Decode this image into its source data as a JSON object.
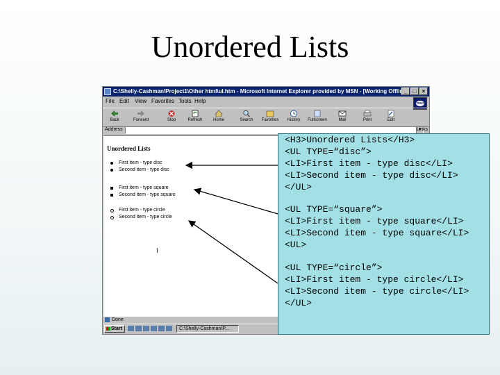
{
  "slide": {
    "title": "Unordered Lists"
  },
  "browser": {
    "title_bar": "C:\\Shelly-Cashman\\Project1\\Other html\\ul.htm - Microsoft Internet Explorer provided by MSN - [Working Offline",
    "menu": [
      "File",
      "Edit",
      "View",
      "Favorites",
      "Tools",
      "Help"
    ],
    "toolbar": [
      "Back",
      "Forward",
      "Stop",
      "Refresh",
      "Home",
      "Search",
      "Favorites",
      "History",
      "Fullscreen",
      "Mail",
      "Print",
      "Edit"
    ],
    "address_label": "Address",
    "address_value": "",
    "links_label": "Links",
    "status_text": "Done",
    "start_label": "Start",
    "task_item": "C:\\Shelly-Cashman\\P..."
  },
  "page": {
    "heading": "Unordered Lists",
    "disc_items": [
      "First item - type disc",
      "Second item - type disc"
    ],
    "square_items": [
      "First item - type square",
      "Second item - type square"
    ],
    "circle_items": [
      "First item - type circle",
      "Second item - type circle"
    ]
  },
  "callout": {
    "block1": [
      "<H3>Unordered Lists</H3>",
      "<UL TYPE=“disc”>",
      "<LI>First item - type disc</LI>",
      "<LI>Second item - type disc</LI>",
      "</UL>"
    ],
    "block2": [
      "<UL TYPE=“square”>",
      "<LI>First item - type square</LI>",
      "<LI>Second item - type square</LI>",
      "<UL>"
    ],
    "block3": [
      "<UL TYPE=“circle”>",
      "<LI>First item - type circle</LI>",
      "<LI>Second item - type circle</LI>",
      "</UL>"
    ]
  },
  "colors": {
    "callout_fill": "#a3e0e6",
    "titlebar": "#0a246a"
  }
}
